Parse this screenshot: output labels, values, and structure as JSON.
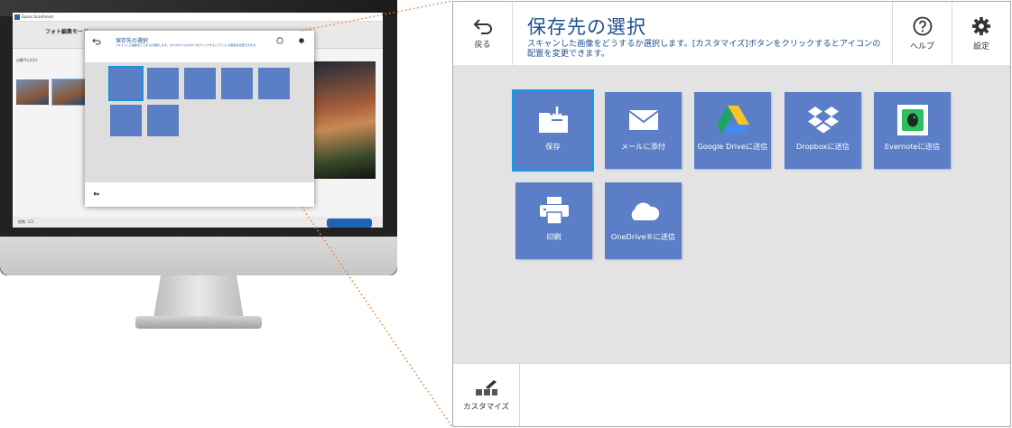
{
  "app": {
    "title": "Epson ScanSmart"
  },
  "background_app": {
    "mode_title": "フォト編集モード",
    "auto_rotate_label": "自動今日付け",
    "status_text": "枚数: 1/2"
  },
  "dialog": {
    "title": "保存先の選択",
    "subtitle": "スキャンした画像をどうするか選択します。[カスタマイズ]ボタンをクリックするとアイコンの配置を変更できます。",
    "back_label": "戻る",
    "help_label": "ヘルプ",
    "settings_label": "設定",
    "customize_label": "カスタマイズ",
    "destinations": [
      {
        "label": "保存",
        "icon": "folder-save-icon",
        "selected": true
      },
      {
        "label": "メールに添付",
        "icon": "mail-icon",
        "selected": false
      },
      {
        "label": "Google Driveに送信",
        "icon": "google-drive-icon",
        "selected": false
      },
      {
        "label": "Dropboxに送信",
        "icon": "dropbox-icon",
        "selected": false
      },
      {
        "label": "Evernoteに送信",
        "icon": "evernote-icon",
        "selected": false
      },
      {
        "label": "印刷",
        "icon": "printer-icon",
        "selected": false
      },
      {
        "label": "OneDrive®に送信",
        "icon": "onedrive-icon",
        "selected": false
      }
    ]
  },
  "colors": {
    "tile": "#5b7ec6",
    "selected_outline": "#1e96e8",
    "title_text": "#1d4f91",
    "body_bg": "#e3e3e3",
    "callout_line": "#e8843a"
  }
}
